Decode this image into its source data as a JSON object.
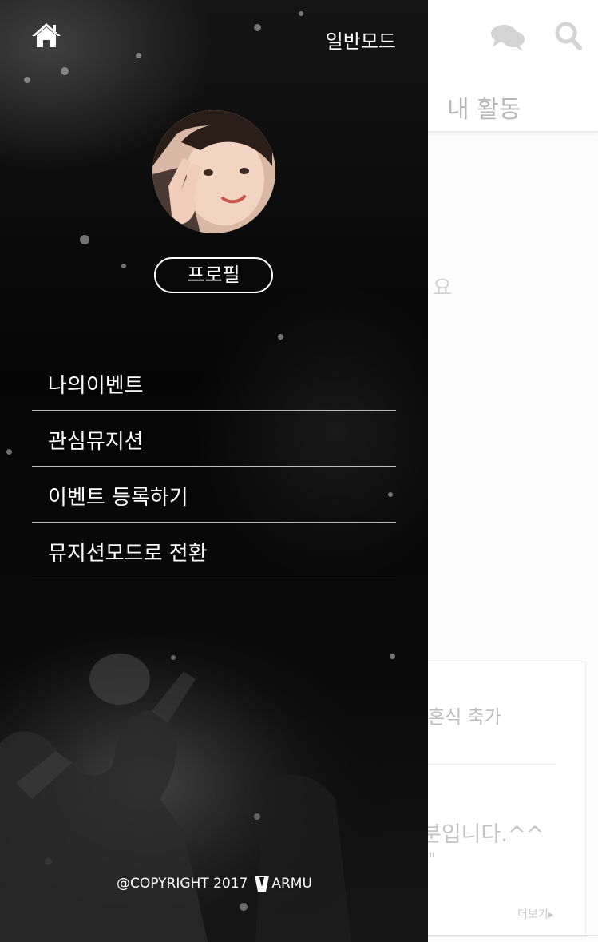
{
  "drawer": {
    "mode_label": "일반모드",
    "profile_button": "프로필",
    "menu_items": [
      {
        "label": "나의이벤트"
      },
      {
        "label": "관심뮤지션"
      },
      {
        "label": "이벤트 등록하기"
      },
      {
        "label": "뮤지션모드로 전환"
      }
    ],
    "copyright_prefix": "@COPYRIGHT 2017",
    "brand_suffix": "ARMU"
  },
  "background": {
    "tab_label": "내 활동",
    "empty_text_fragment": "요",
    "card": {
      "title_fragment": "혼식 축가",
      "body_fragment": "분입니다.^^",
      "quote_fragment": "\"",
      "more_label": "더보기▸"
    }
  },
  "icons": {
    "home": "home-icon",
    "chat": "chat-bubbles-icon",
    "search": "search-icon",
    "logo": "varmu-logo-icon"
  },
  "colors": {
    "drawer_bg": "#050505",
    "drawer_text": "#ffffff",
    "divider": "#bdbdbd",
    "bg_icon_gray": "#d4d4d4",
    "bg_text_gray": "#b7b7b7"
  }
}
